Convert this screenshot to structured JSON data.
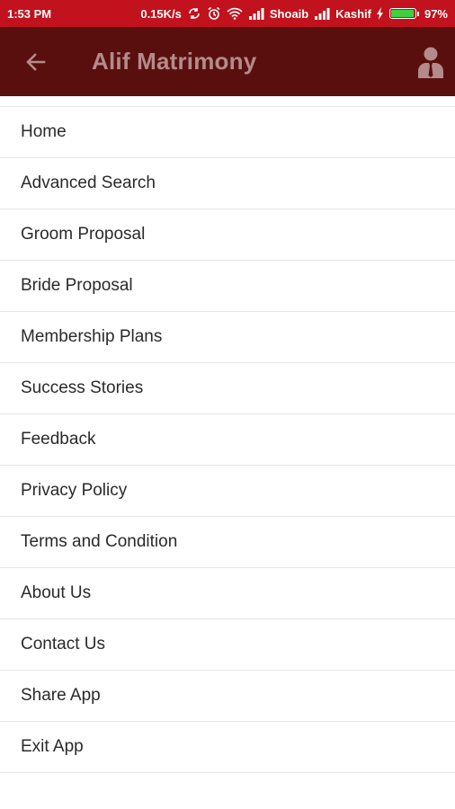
{
  "status_bar": {
    "time": "1:53 PM",
    "speed": "0.15K/s",
    "carrier1": "Shoaib",
    "carrier2": "Kashif",
    "battery": "97%",
    "battery_level": 0.97,
    "background": "#c1121d"
  },
  "app_bar": {
    "title": "Alif Matrimony",
    "back_icon": "arrow-left-icon",
    "profile_icon": "user-profile-icon",
    "background": "#5a0f0f",
    "title_color": "#b38b8b"
  },
  "menu": {
    "items": [
      {
        "label": "Home"
      },
      {
        "label": "Advanced Search"
      },
      {
        "label": "Groom Proposal"
      },
      {
        "label": "Bride Proposal"
      },
      {
        "label": "Membership Plans"
      },
      {
        "label": "Success Stories"
      },
      {
        "label": "Feedback"
      },
      {
        "label": "Privacy Policy"
      },
      {
        "label": "Terms and Condition"
      },
      {
        "label": "About Us"
      },
      {
        "label": "Contact Us"
      },
      {
        "label": "Share App"
      },
      {
        "label": "Exit App"
      }
    ]
  }
}
